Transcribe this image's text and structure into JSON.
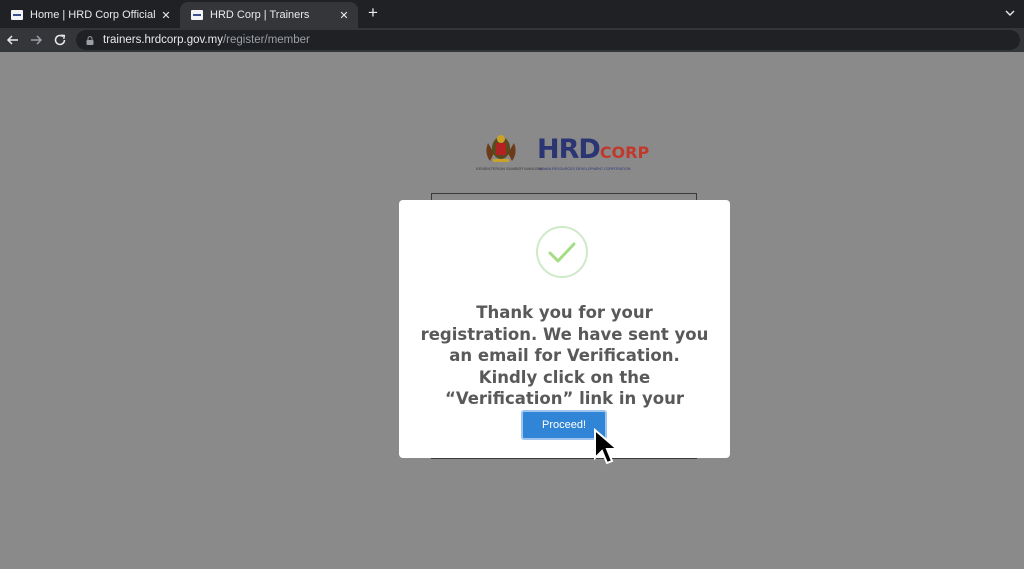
{
  "browser": {
    "tabs": [
      {
        "title": "Home | HRD Corp Official Portal",
        "close": "✕"
      },
      {
        "title": "HRD Corp | Trainers",
        "close": "✕"
      }
    ],
    "new_tab": "+",
    "url_host": "trainers.hrdcorp.gov.my",
    "url_path": "/register/member",
    "icons": [
      "back-arrow-icon",
      "forward-arrow-icon",
      "reload-icon",
      "lock-icon",
      "tab-search-chevron-icon"
    ]
  },
  "header": {
    "crest_caption": "KEMENTERIAN SUMBER MANUSIA",
    "brand_main": "HRD",
    "brand_sub": "CORP",
    "brand_tagline": "HUMAN RESOURCES DEVELOPMENT CORPORATION"
  },
  "modal": {
    "icon": "success-check-icon",
    "message": "Thank you for your registration. We have sent you an email for Verification. Kindly click on the “Verification” link in your email",
    "button_label": "Proceed!",
    "button_color": "#3085d6",
    "check_color": "#a5dc86"
  },
  "colors": {
    "overlay": "#8a8a8b",
    "brand_blue": "#2b3573",
    "brand_red": "#c0392b"
  }
}
